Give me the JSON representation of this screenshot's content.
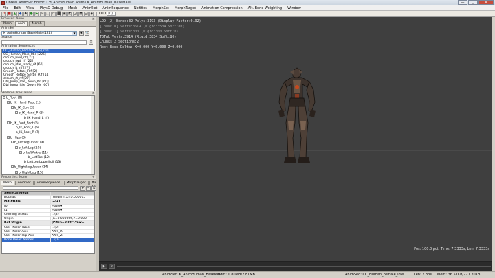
{
  "window": {
    "title": "Unreal AnimSet Editor: CH_AnimHuman.Anims.K_AnimHuman_BaseMale",
    "minimize": "—",
    "maximize": "□",
    "close": "✕"
  },
  "menu": [
    "File",
    "Edit",
    "View",
    "PhysX Debug",
    "Mesh",
    "AnimSet",
    "AnimSequence",
    "Notifies",
    "MorphSet",
    "MorphTarget",
    "Animation Compression",
    "Alt. Bone Weighting",
    "Window"
  ],
  "toolbar": {
    "lod_label": "LOD",
    "lod_value": "[0]",
    "icons": [
      "↺",
      "■",
      "▲",
      "◆",
      "✚",
      "●",
      "▶",
      "✂",
      "⬚",
      "⇄",
      "⬛",
      "▣",
      "◩",
      "◪",
      "⬒",
      "⬓",
      "◈"
    ]
  },
  "browser": {
    "header": "Browser: None",
    "tabs": [
      "Mesh",
      "Anim",
      "Morph"
    ],
    "animset_label": "AnimSet",
    "animset_value": "K_AnimHuman_BaseMale (124)",
    "search_label": "Search",
    "sequences_label": "Animation Sequences",
    "sequences": [
      "CC_Human_Female_Idle [200]",
      "CC_Human_Male_Idle [226]",
      "crouch_bwd_rif [22]",
      "crouch_fwd_rif [22]",
      "crouch_idle_ready_rif [60]",
      "crouch_lt_rif [27]",
      "Crouch_Rotate_Rif [2]",
      "Crouch_Rotate_Settle_Rif [14]",
      "crouch_rt_rif [27]",
      "Dbl_Jump_Idle_Down_Rif [60]",
      "Dbl_Jump_Idle_Down_Pis [60]"
    ]
  },
  "skeleton": {
    "header": "Skeleton Tree: None",
    "bones": [
      {
        "name": "b_Root (0)",
        "level": 0,
        "expand": "-"
      },
      {
        "name": "b_IK_Hand_Root (1)",
        "level": 1,
        "expand": "-"
      },
      {
        "name": "b_IK_Gun (2)",
        "level": 2,
        "expand": "-"
      },
      {
        "name": "b_IK_Hand_R (3)",
        "level": 3,
        "expand": "-"
      },
      {
        "name": "b_IK_Hand_L (4)",
        "level": 4,
        "expand": ""
      },
      {
        "name": "b_IK_Foot_Root (5)",
        "level": 1,
        "expand": "-"
      },
      {
        "name": "b_IK_Foot_L (6)",
        "level": 2,
        "expand": ""
      },
      {
        "name": "b_IK_Foot_R (7)",
        "level": 2,
        "expand": ""
      },
      {
        "name": "b_Hips (8)",
        "level": 1,
        "expand": "-"
      },
      {
        "name": "b_LeftLegUpper (9)",
        "level": 2,
        "expand": "-"
      },
      {
        "name": "b_LeftLeg (10)",
        "level": 3,
        "expand": "-"
      },
      {
        "name": "b_LeftAnkle (11)",
        "level": 4,
        "expand": "-"
      },
      {
        "name": "b_LeftToe (12)",
        "level": 5,
        "expand": ""
      },
      {
        "name": "b_LeftLegUpperRoll (13)",
        "level": 4,
        "expand": ""
      },
      {
        "name": "b_RightLegUpper (14)",
        "level": 2,
        "expand": "-"
      },
      {
        "name": "b_RightLeg (15)",
        "level": 3,
        "expand": "-"
      },
      {
        "name": "b_RightAnkle (16)",
        "level": 4,
        "expand": ""
      }
    ]
  },
  "properties": {
    "header": "Properties: None",
    "tabs": [
      "Mesh",
      "AnimSet",
      "AnimSequence",
      "MorphTarget",
      "Mesh Sr"
    ],
    "rows": [
      {
        "key": "Skeletal Mesh",
        "value": "",
        "kind": "cat"
      },
      {
        "key": "Bounds",
        "value": "(Origin=(X=0.000015",
        "kind": ""
      },
      {
        "key": "Materials",
        "value": "...(2)",
        "kind": "sub"
      },
      {
        "key": "[0]",
        "value": "Mater▾",
        "kind": ""
      },
      {
        "key": "[1]",
        "value": "Mater▾",
        "kind": ""
      },
      {
        "key": "Clothing Assets",
        "value": "...(2)",
        "kind": ""
      },
      {
        "key": "Origin",
        "value": "(X=0.000000,Y=0.000",
        "kind": ""
      },
      {
        "key": "Rot Origin",
        "value": "(Pitch=0.00°,Yaw=·",
        "kind": "sub"
      },
      {
        "key": "Skel Mirror Table",
        "value": "...(0)",
        "kind": ""
      },
      {
        "key": "Skel Mirror Axis",
        "value": "AXIS_X",
        "kind": ""
      },
      {
        "key": "Skel Mirror Flip Axis",
        "value": "AXIS_Z",
        "kind": ""
      },
      {
        "key": "Bone Break Names",
        "value": "...(0)",
        "kind": "sel"
      }
    ]
  },
  "viewport": {
    "hud_lines": [
      {
        "text": "LOD [2] Bones:32 Polys:3193 (Display Factor:0.92)",
        "dim": false
      },
      {
        "text": " [Chunk 0] Verts:3614 (Rigid:3534 Soft:80)",
        "dim": true
      },
      {
        "text": " [Chunk 1] Verts:300 (Rigid:300 Soft:0)",
        "dim": true
      },
      {
        "text": "TOTAL Verts:3914 (Rigid:3834 Soft:80)",
        "dim": false
      },
      {
        "text": "Chunks:2 Sections:2",
        "dim": false
      },
      {
        "text": "Root Bone Delta: X=0.000 Y=0.000 Z=0.000",
        "dim": false
      }
    ],
    "pos_readout": "Pos: 100.0 pct, Time: 7.3333s, Len: 7.3333s"
  },
  "status": {
    "animset": "AnimSet: K_AnimHuman_BaseMale",
    "mem": "Mem: 0.80MB/2.81MB",
    "animseq": "AnimSeq: CC_Human_Female_Idle",
    "len": "Len: 7.33s",
    "mem2": "Mem: 36.57KB/221.70KB"
  }
}
